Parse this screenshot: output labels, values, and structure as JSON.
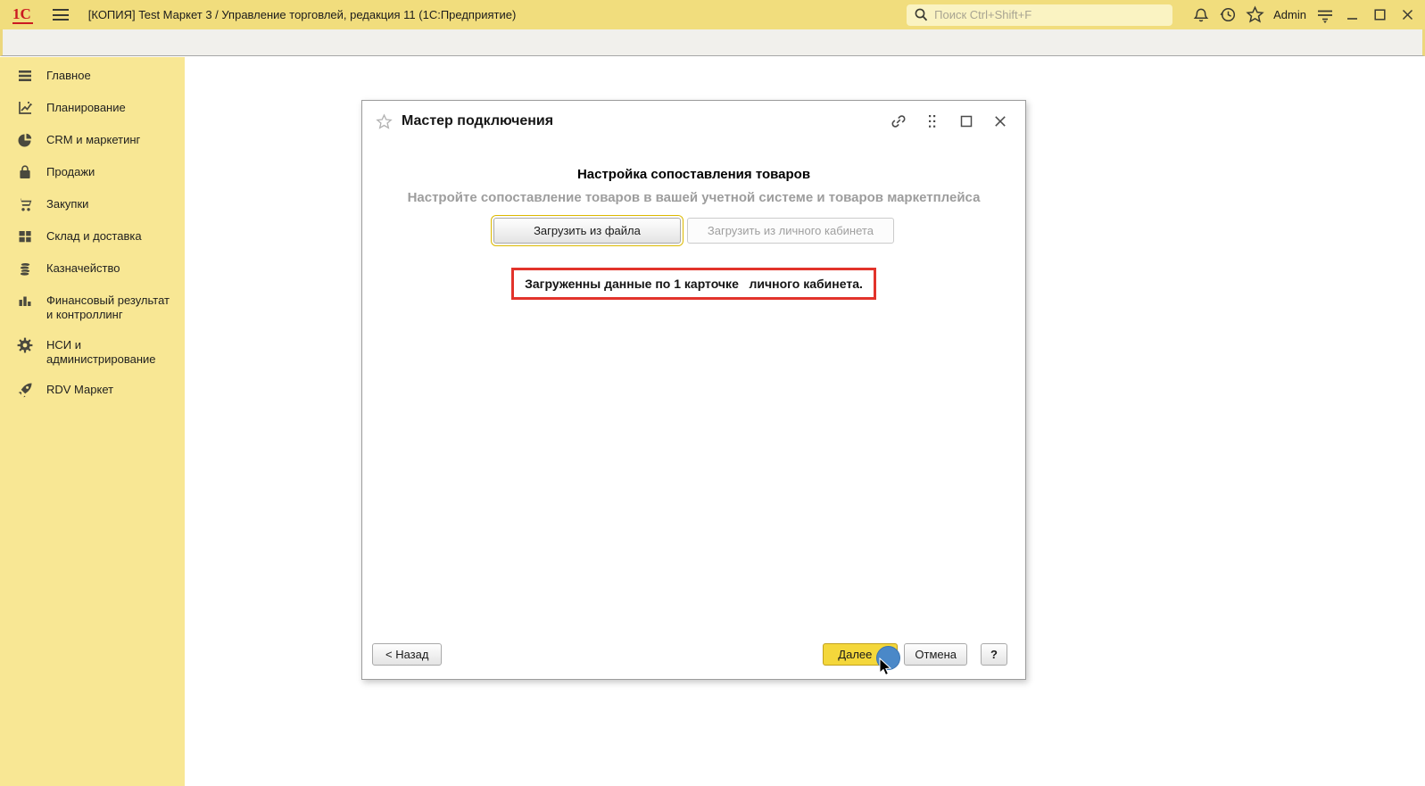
{
  "titlebar": {
    "logo": "1С",
    "app_title": "[КОПИЯ] Test Маркет 3 / Управление торговлей, редакция 11  (1С:Предприятие)",
    "search_placeholder": "Поиск Ctrl+Shift+F",
    "user": "Admin"
  },
  "sidebar": {
    "items": [
      {
        "label": "Главное",
        "icon": "menu-lines-icon"
      },
      {
        "label": "Планирование",
        "icon": "planning-chart-icon"
      },
      {
        "label": "CRM и маркетинг",
        "icon": "pie-chart-icon"
      },
      {
        "label": "Продажи",
        "icon": "shopping-bag-icon"
      },
      {
        "label": "Закупки",
        "icon": "shopping-cart-icon"
      },
      {
        "label": "Склад и доставка",
        "icon": "warehouse-grid-icon"
      },
      {
        "label": "Казначейство",
        "icon": "coins-icon"
      },
      {
        "label": "Финансовый результат и контроллинг",
        "icon": "bar-chart-icon"
      },
      {
        "label": "НСИ и администрирование",
        "icon": "gear-icon"
      },
      {
        "label": "RDV Маркет",
        "icon": "rocket-icon"
      }
    ]
  },
  "dialog": {
    "title": "Мастер подключения",
    "heading": "Настройка сопоставления товаров",
    "subtitle": "Настройте сопоставление товаров в вашей учетной системе и товаров маркетплейса",
    "load_from_file_button": "Загрузить из файла",
    "load_from_cabinet_button": "Загрузить из личного кабинета",
    "status_message": "Загруженны данные по 1 карточке   личного кабинета.",
    "back_button": "< Назад",
    "next_button": "Далее",
    "cancel_button": "Отмена",
    "help_button": "?"
  },
  "colors": {
    "titlebar_bg": "#f1dd7d",
    "sidebar_bg": "#f8e794",
    "toolbar_bg": "#f1f0ec",
    "search_bg": "#faf3c2",
    "next_button_bg": "#f4d73b",
    "focus_outline_yellow": "#dcb900",
    "alert_border_red": "#e2332b",
    "click_indicator_blue": "#4a88c8",
    "logo_red": "#cb1a21"
  }
}
